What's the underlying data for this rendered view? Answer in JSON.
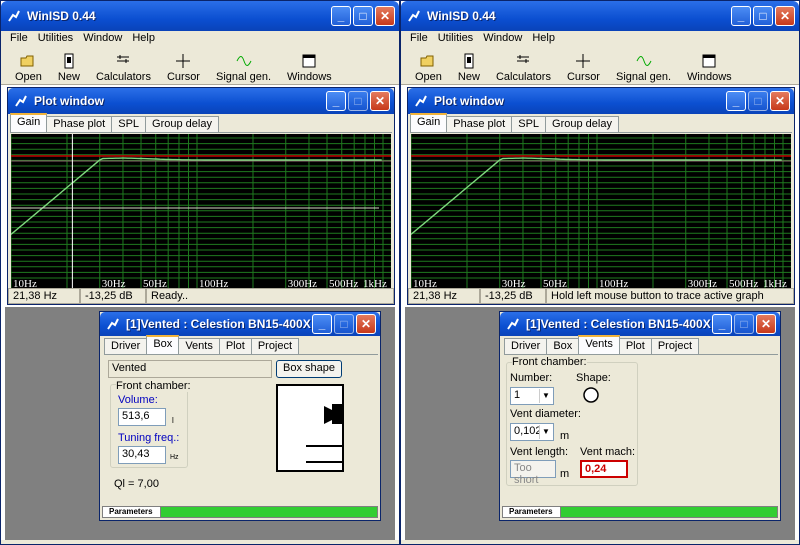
{
  "left": {
    "app_title": "WinISD 0.44",
    "menu": [
      "File",
      "Utilities",
      "Window",
      "Help"
    ],
    "toolbar": [
      "Open",
      "New",
      "Calculators",
      "Cursor",
      "Signal gen.",
      "Windows"
    ],
    "plot": {
      "title": "Plot window",
      "tabs": [
        "Gain",
        "Phase plot",
        "SPL",
        "Group delay"
      ],
      "x_labels": [
        "10Hz",
        "30Hz",
        "50Hz",
        "100Hz",
        "300Hz",
        "500Hz",
        "1kHz"
      ],
      "status": [
        "21,38 Hz",
        "-13,25 dB",
        "Ready.."
      ]
    },
    "sub": {
      "title": "[1]Vented : Celestion BN15-400X",
      "tabs": [
        "Driver",
        "Box",
        "Vents",
        "Plot",
        "Project"
      ],
      "box_type": "Vented",
      "box_shape_button": "Box shape",
      "front_chamber": "Front chamber:",
      "volume_label": "Volume:",
      "volume_value": "513,6",
      "volume_unit": "l",
      "tuning_label": "Tuning freq.:",
      "tuning_value": "30,43",
      "tuning_unit": "Hz",
      "ql": "Ql = 7,00",
      "progress_label": "Parameters"
    }
  },
  "right": {
    "app_title": "WinISD 0.44",
    "menu": [
      "File",
      "Utilities",
      "Window",
      "Help"
    ],
    "toolbar": [
      "Open",
      "New",
      "Calculators",
      "Cursor",
      "Signal gen.",
      "Windows"
    ],
    "plot": {
      "title": "Plot window",
      "tabs": [
        "Gain",
        "Phase plot",
        "SPL",
        "Group delay"
      ],
      "x_labels": [
        "10Hz",
        "30Hz",
        "50Hz",
        "100Hz",
        "300Hz",
        "500Hz",
        "1kHz"
      ],
      "status": [
        "21,38 Hz",
        "-13,25 dB",
        "Hold left mouse button to trace active graph"
      ]
    },
    "sub": {
      "title": "[1]Vented : Celestion BN15-400X",
      "tabs": [
        "Driver",
        "Box",
        "Vents",
        "Plot",
        "Project"
      ],
      "front_chamber": "Front chamber:",
      "number_label": "Number:",
      "number_value": "1",
      "shape_label": "Shape:",
      "diameter_label": "Vent diameter:",
      "diameter_value": "0,102",
      "diameter_unit": "m",
      "length_label": "Vent length:",
      "length_value": "Too short",
      "length_unit": "m",
      "mach_label": "Vent mach:",
      "mach_value": "0,24",
      "progress_label": "Parameters"
    }
  },
  "colors": {
    "title_blue": "#0b4fd1",
    "graph_bg": "#000000",
    "grid_green": "#1f7a1f",
    "curve": "#7fd87f",
    "ref_red": "#c00000",
    "mach_red": "#cc0000"
  }
}
